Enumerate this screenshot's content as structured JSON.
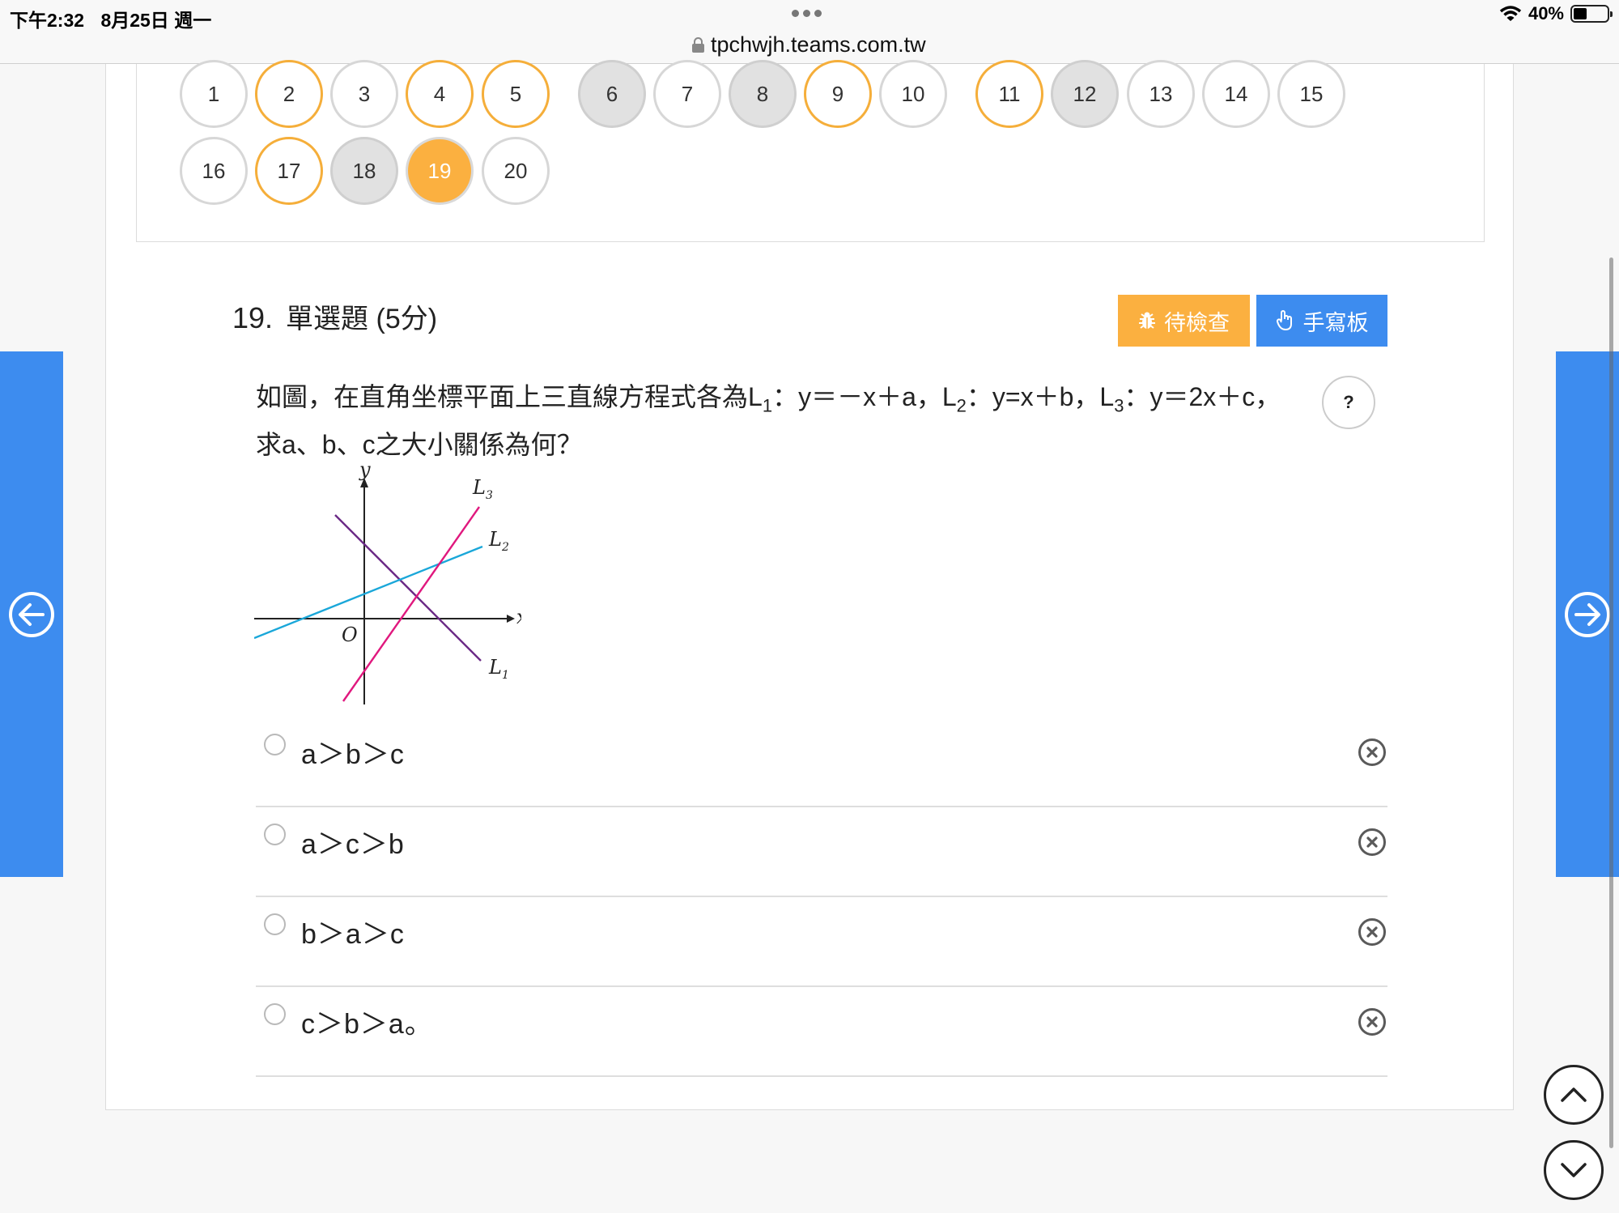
{
  "status_bar": {
    "time": "下午2:32",
    "date": "8月25日 週一",
    "url": "tpchwjh.teams.com.tw",
    "battery": "40%",
    "battery_level": 0.4
  },
  "question_nav": [
    {
      "label": "1",
      "state": "default"
    },
    {
      "label": "2",
      "state": "pending"
    },
    {
      "label": "3",
      "state": "default"
    },
    {
      "label": "4",
      "state": "pending"
    },
    {
      "label": "5",
      "state": "pending"
    },
    {
      "label": "6",
      "state": "seen"
    },
    {
      "label": "7",
      "state": "default"
    },
    {
      "label": "8",
      "state": "seen"
    },
    {
      "label": "9",
      "state": "pending"
    },
    {
      "label": "10",
      "state": "default"
    },
    {
      "label": "11",
      "state": "pending"
    },
    {
      "label": "12",
      "state": "seen"
    },
    {
      "label": "13",
      "state": "default"
    },
    {
      "label": "14",
      "state": "default"
    },
    {
      "label": "15",
      "state": "default"
    },
    {
      "label": "16",
      "state": "default"
    },
    {
      "label": "17",
      "state": "pending"
    },
    {
      "label": "18",
      "state": "seen"
    },
    {
      "label": "19",
      "state": "current"
    },
    {
      "label": "20",
      "state": "default"
    }
  ],
  "question": {
    "number": "19.",
    "type": "單選題 (5分)",
    "check_button": "待檢查",
    "handwriting_button": "手寫板",
    "help": "?",
    "text_a": "如圖，在直角坐標平面上三直線方程式各為L",
    "sub1": "1",
    "text_b": "：y＝－x＋a，L",
    "sub2": "2",
    "text_c": "：y=x＋b，L",
    "sub3": "3",
    "text_d": "：y＝2x＋c，求a、b、c之大小關係為何？",
    "figure_labels": {
      "y": "y",
      "x": "x",
      "origin": "O",
      "l1": "L",
      "l1_sub": "1",
      "l2": "L",
      "l2_sub": "2",
      "l3": "L",
      "l3_sub": "3"
    },
    "options": [
      {
        "text": "a＞b＞c"
      },
      {
        "text": "a＞c＞b"
      },
      {
        "text": "b＞a＞c"
      },
      {
        "text": "c＞b＞a。"
      }
    ]
  },
  "colors": {
    "orange": "#fbb040",
    "blue": "#3d8cef",
    "line_l1": "#6b2a86",
    "line_l2": "#1aa7d9",
    "line_l3": "#e0187e"
  },
  "icons": {
    "prev": "arrow-left-circle-icon",
    "next": "arrow-right-circle-icon",
    "scroll_up": "chevron-up-icon",
    "scroll_down": "chevron-down-icon",
    "check": "bug-icon",
    "handwriting": "pointing-hand-icon",
    "remove": "x-circle-icon"
  }
}
